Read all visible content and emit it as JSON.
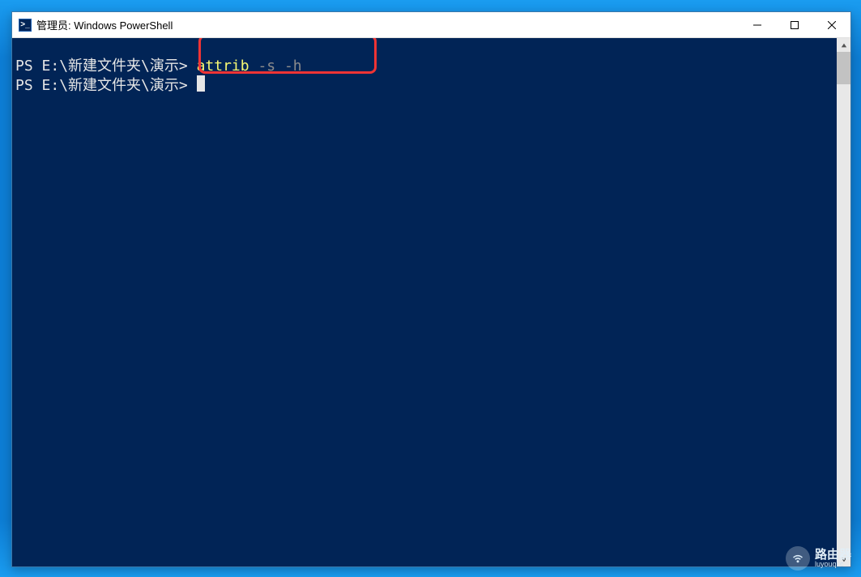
{
  "window": {
    "title": "管理员: Windows PowerShell"
  },
  "console": {
    "line1": {
      "prompt_prefix": "PS ",
      "path": "E:\\新建文件夹\\演示",
      "gt": "> ",
      "cmd": "attrib",
      "space1": " ",
      "flag1": "-s",
      "space2": " ",
      "flag2": "-h"
    },
    "line2": {
      "prompt_prefix": "PS ",
      "path": "E:\\新建文件夹\\演示",
      "gt": ">"
    }
  },
  "watermark": {
    "title": "路由器",
    "sub": "luyouqi.c"
  }
}
